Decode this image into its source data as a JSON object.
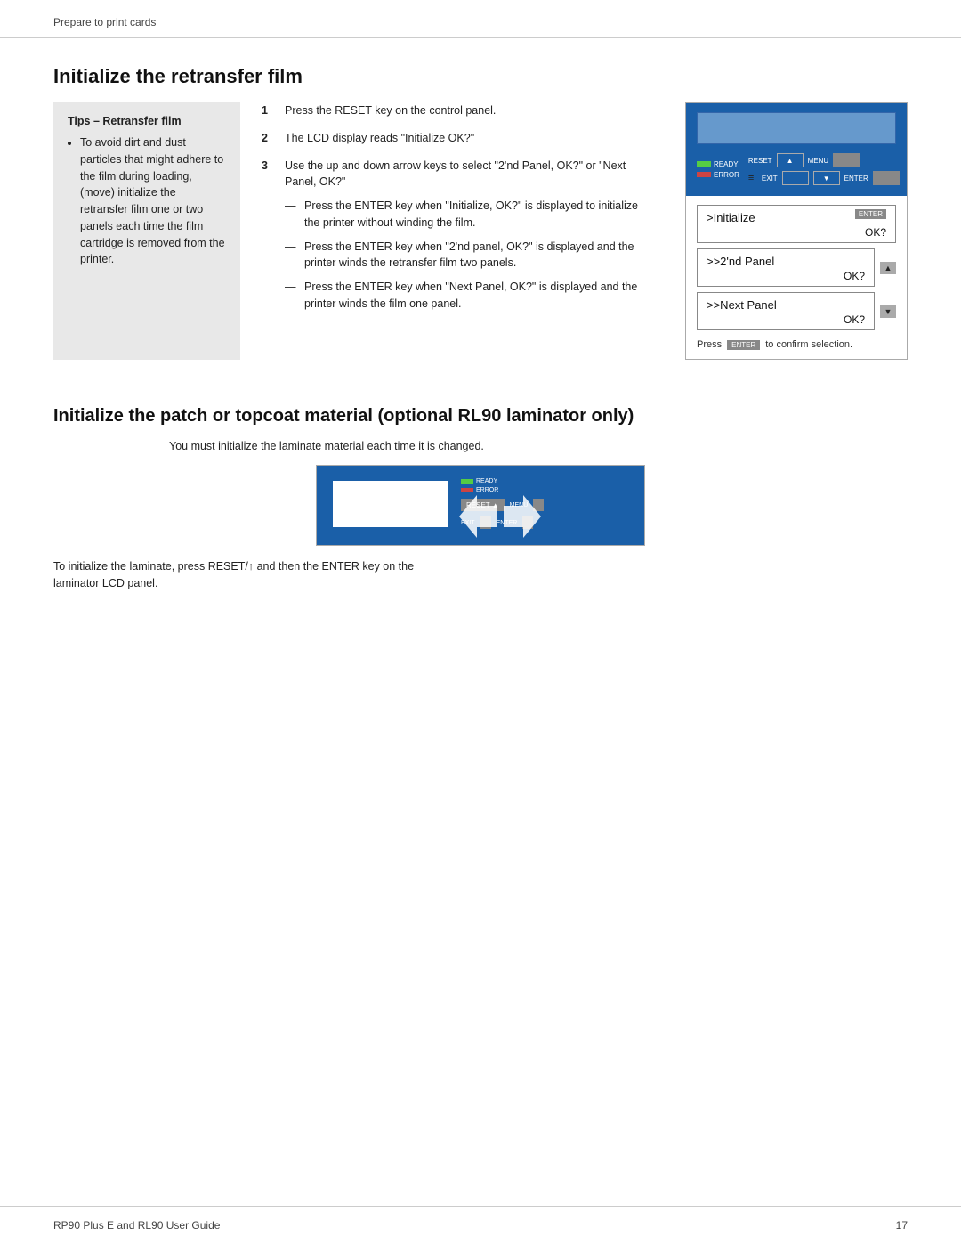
{
  "header": {
    "breadcrumb": "Prepare to print cards"
  },
  "section1": {
    "title": "Initialize the retransfer film",
    "tips": {
      "heading": "Tips – Retransfer film",
      "items": [
        "To avoid dirt and dust particles that might adhere to the film during loading, (move) initialize the retransfer film one or two panels each time the film cartridge is removed from the printer."
      ]
    },
    "steps": [
      {
        "num": "1",
        "text": "Press the RESET key on the control panel."
      },
      {
        "num": "2",
        "text": "The LCD display reads \"Initialize OK?\""
      },
      {
        "num": "3",
        "text": "Use the up and down arrow keys to select \"2'nd Panel, OK?\" or \"Next Panel, OK?\""
      }
    ],
    "substeps": [
      "Press the ENTER key when \"Initialize, OK?\" is displayed to initialize the printer without winding the film.",
      "Press the ENTER key when \"2'nd panel, OK?\" is displayed and the printer winds the retransfer film two panels.",
      "Press the ENTER key when \"Next Panel, OK?\" is displayed and the printer winds the film one panel."
    ],
    "panel": {
      "indicators": [
        {
          "label": "READY",
          "color": "green"
        },
        {
          "label": "ERROR",
          "color": "red"
        }
      ],
      "buttons": [
        "RESET",
        "▲",
        "MENU",
        "EXIT",
        "▼",
        "ENTER"
      ],
      "options": [
        {
          "label": ">Initialize",
          "ok": "OK?",
          "enter_badge": "ENTER"
        },
        {
          "label": ">>2'nd Panel",
          "ok": "OK?"
        },
        {
          "label": ">>Next Panel",
          "ok": "OK?"
        }
      ],
      "confirm_text": "Press",
      "confirm_badge": "ENTER",
      "confirm_suffix": "to confirm selection."
    }
  },
  "section2": {
    "title": "Initialize the patch or topcoat material (optional RL90 laminator only)",
    "intro": "You must initialize the laminate material each time it is changed.",
    "caption_line1": "To initialize the laminate, press RESET/↑ and then the ENTER key on the",
    "caption_line2": "laminator LCD panel.",
    "lam_panel": {
      "indicators": [
        {
          "label": "READY",
          "color": "green"
        },
        {
          "label": "ERROR",
          "color": "red"
        }
      ],
      "buttons_top": [
        "RESET ▲",
        "MENU"
      ],
      "buttons_bottom": [
        "EXIT",
        "ENTER"
      ]
    }
  },
  "footer": {
    "left": "RP90 Plus E and RL90 User Guide",
    "right": "17"
  }
}
